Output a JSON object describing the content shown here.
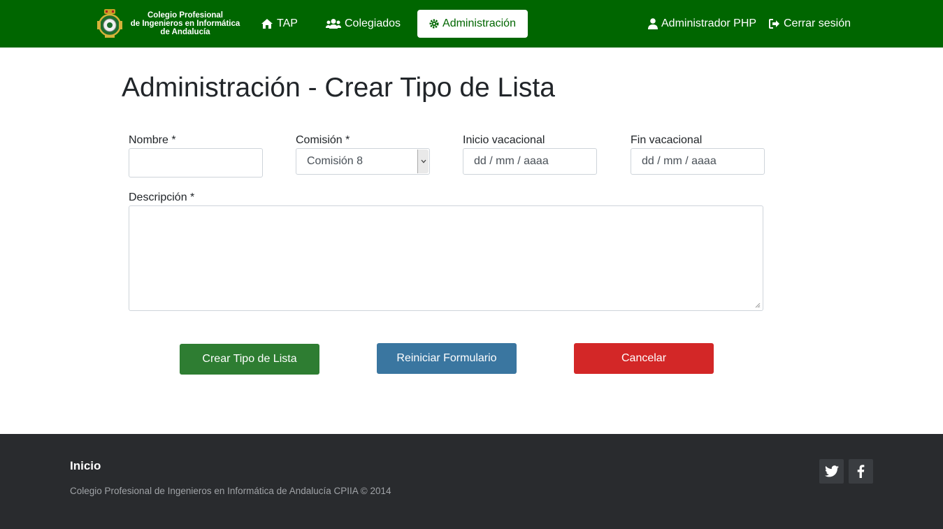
{
  "brand": {
    "line1": "Colegio Profesional",
    "line2": "de Ingenieros en Informática",
    "line3": "de Andalucía"
  },
  "nav": {
    "tap": "TAP",
    "colegiados": "Colegiados",
    "administracion": "Administración",
    "user": "Administrador PHP",
    "logout": "Cerrar sesión"
  },
  "page": {
    "title": "Administración - Crear Tipo de Lista"
  },
  "form": {
    "nombre_label": "Nombre *",
    "nombre_value": "",
    "comision_label": "Comisión *",
    "comision_value": "Comisión 8",
    "inicio_label": "Inicio vacacional",
    "inicio_placeholder": "dd / mm / aaaa",
    "fin_label": "Fin vacacional",
    "fin_placeholder": "dd / mm / aaaa",
    "descripcion_label": "Descripción *",
    "descripcion_value": ""
  },
  "buttons": {
    "create": "Crear Tipo de Lista",
    "reset": "Reiniciar Formulario",
    "cancel": "Cancelar"
  },
  "footer": {
    "title": "Inicio",
    "copyright": "Colegio Profesional de Ingenieros en Informática de Andalucía CPIIA © 2014"
  },
  "colors": {
    "navbar": "#006600",
    "create": "#2e7d32",
    "reset": "#3a76a0",
    "cancel": "#d32727",
    "footer": "#292b2e"
  }
}
